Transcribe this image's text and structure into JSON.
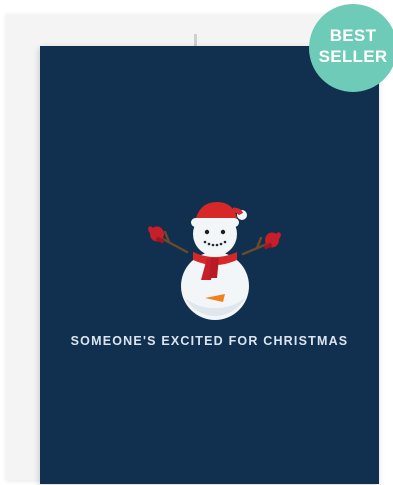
{
  "product": {
    "card_text": "SOMEONE'S EXCITED FOR CHRISTMAS",
    "illustration": "snowman-with-santa-hat-and-scarf"
  },
  "badge": {
    "line1": "BEST",
    "line2": "SELLER"
  },
  "colors": {
    "card": "#11304f",
    "badge": "#6dcbb7",
    "scarf": "#d62828",
    "envelope": "#f4f4f4"
  }
}
